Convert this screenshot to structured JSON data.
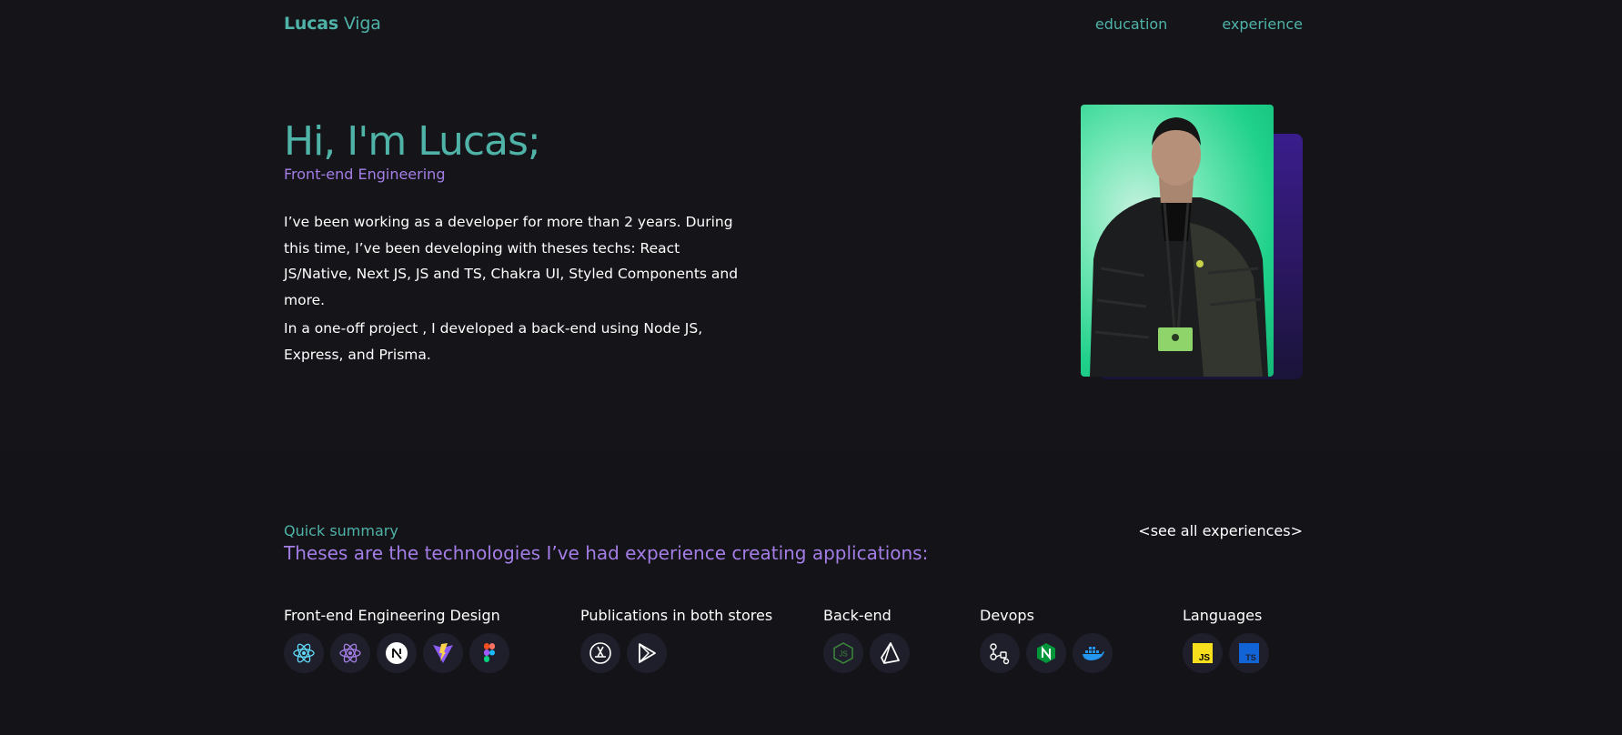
{
  "header": {
    "logo_first": "Lucas",
    "logo_last": " Viga",
    "nav": [
      {
        "label": "education"
      },
      {
        "label": "experience"
      }
    ]
  },
  "hero": {
    "title": "Hi, I'm Lucas;",
    "subtitle": "Front-end Engineering",
    "paragraph1": "I’ve been working as a developer for more than 2 years. During this time, I’ve been developing with theses techs: React JS/Native, Next JS, JS and TS, Chakra UI, Styled Components and more.",
    "paragraph2": "In a one-off project , I developed a back-end using Node JS, Express, and Prisma."
  },
  "summary": {
    "label": "Quick summary",
    "title": "Theses are the technologies I’ve had experience creating applications:",
    "see_all": "<see all experiences>",
    "groups": [
      {
        "title": "Front-end Engineering Design",
        "icons": [
          "react-icon",
          "react-native-icon",
          "nextjs-icon",
          "vite-icon",
          "figma-icon"
        ]
      },
      {
        "title": "Publications in both stores",
        "icons": [
          "app-store-icon",
          "google-play-icon"
        ]
      },
      {
        "title": "Back-end",
        "icons": [
          "nodejs-icon",
          "prisma-icon"
        ]
      },
      {
        "title": "Devops",
        "icons": [
          "git-actions-icon",
          "nginx-icon",
          "docker-icon"
        ]
      },
      {
        "title": "Languages",
        "icons": [
          "javascript-icon",
          "typescript-icon"
        ]
      }
    ]
  },
  "colors": {
    "background": "#141419",
    "accent_teal": "#4fb3a8",
    "accent_purple": "#a47ee6"
  }
}
